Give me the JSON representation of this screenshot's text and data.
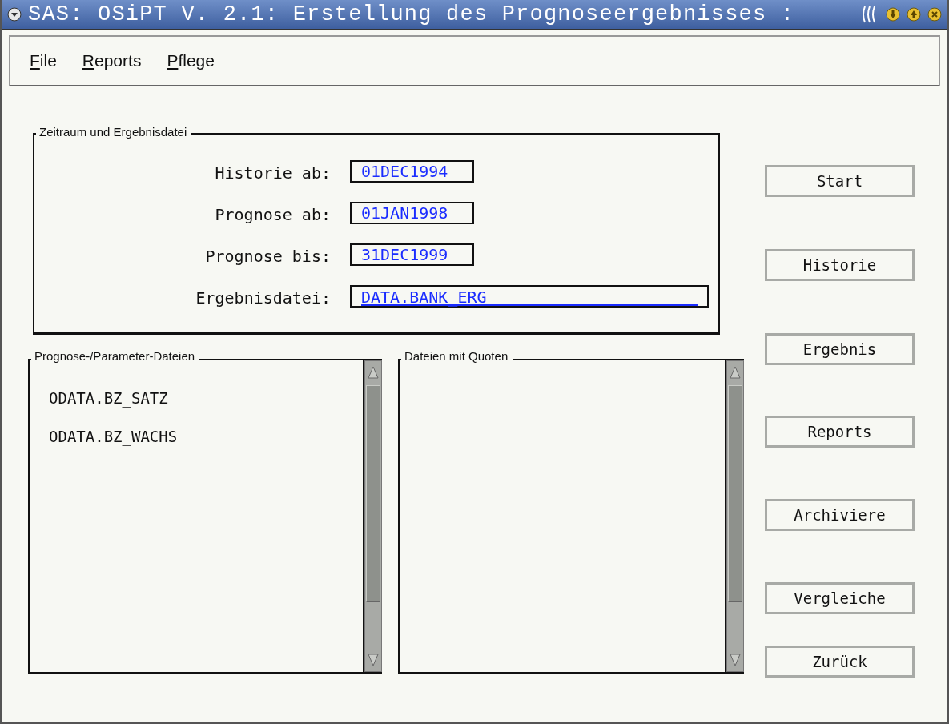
{
  "window": {
    "title": "SAS: OSiPT V. 2.1: Erstellung des Prognoseergebnisses :"
  },
  "menu": [
    {
      "label": "File"
    },
    {
      "label": "Reports"
    },
    {
      "label": "Pflege"
    }
  ],
  "period_group": {
    "title": "Zeitraum und Ergebnisdatei",
    "fields": [
      {
        "label": "Historie ab:",
        "value": "01DEC1994",
        "kind": "date"
      },
      {
        "label": "Prognose ab:",
        "value": "01JAN1998",
        "kind": "date"
      },
      {
        "label": "Prognose bis:",
        "value": "31DEC1999",
        "kind": "date"
      },
      {
        "label": "Ergebnisdatei:",
        "value": "DATA.BANK_ERG",
        "kind": "file"
      }
    ]
  },
  "lists": [
    {
      "title": "Prognose-/Parameter-Dateien",
      "items": [
        "ODATA.BZ_SATZ",
        "ODATA.BZ_WACHS"
      ]
    },
    {
      "title": "Dateien mit Quoten"
    }
  ],
  "buttons": [
    "Start",
    "Historie",
    "Ergebnis",
    "Reports",
    "Archiviere",
    "Vergleiche",
    "Zurück"
  ]
}
